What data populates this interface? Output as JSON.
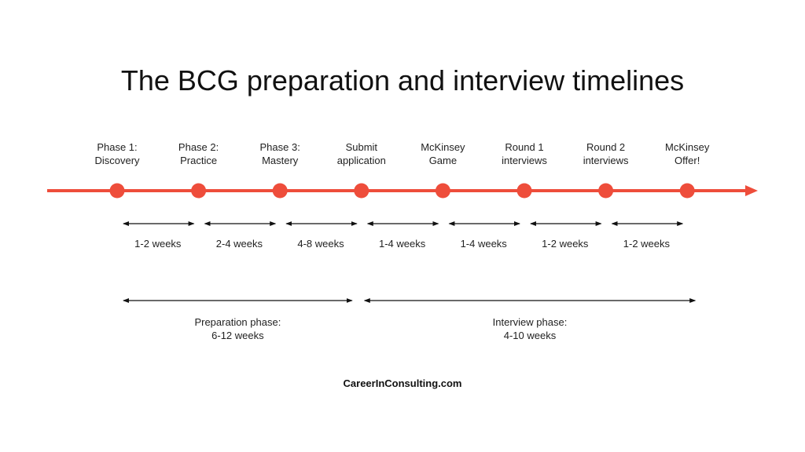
{
  "title": "The BCG preparation and interview timelines",
  "colors": {
    "timeline": "#EE4D3B",
    "arrows": "#111111"
  },
  "steps": [
    {
      "line1": "Phase 1:",
      "line2": "Discovery"
    },
    {
      "line1": "Phase 2:",
      "line2": "Practice"
    },
    {
      "line1": "Phase 3:",
      "line2": "Mastery"
    },
    {
      "line1": "Submit",
      "line2": "application"
    },
    {
      "line1": "McKinsey",
      "line2": "Game"
    },
    {
      "line1": "Round 1",
      "line2": "interviews"
    },
    {
      "line1": "Round 2",
      "line2": "interviews"
    },
    {
      "line1": "McKinsey",
      "line2": "Offer!"
    }
  ],
  "durations": [
    "1-2 weeks",
    "2-4 weeks",
    "4-8 weeks",
    "1-4 weeks",
    "1-4 weeks",
    "1-2 weeks",
    "1-2 weeks"
  ],
  "phases": [
    {
      "line1": "Preparation phase:",
      "line2": "6-12 weeks",
      "from_step": 0,
      "to_step": 3
    },
    {
      "line1": "Interview phase:",
      "line2": "4-10 weeks",
      "from_step": 3,
      "to_step": 7
    }
  ],
  "footer": "CareerInConsulting.com"
}
